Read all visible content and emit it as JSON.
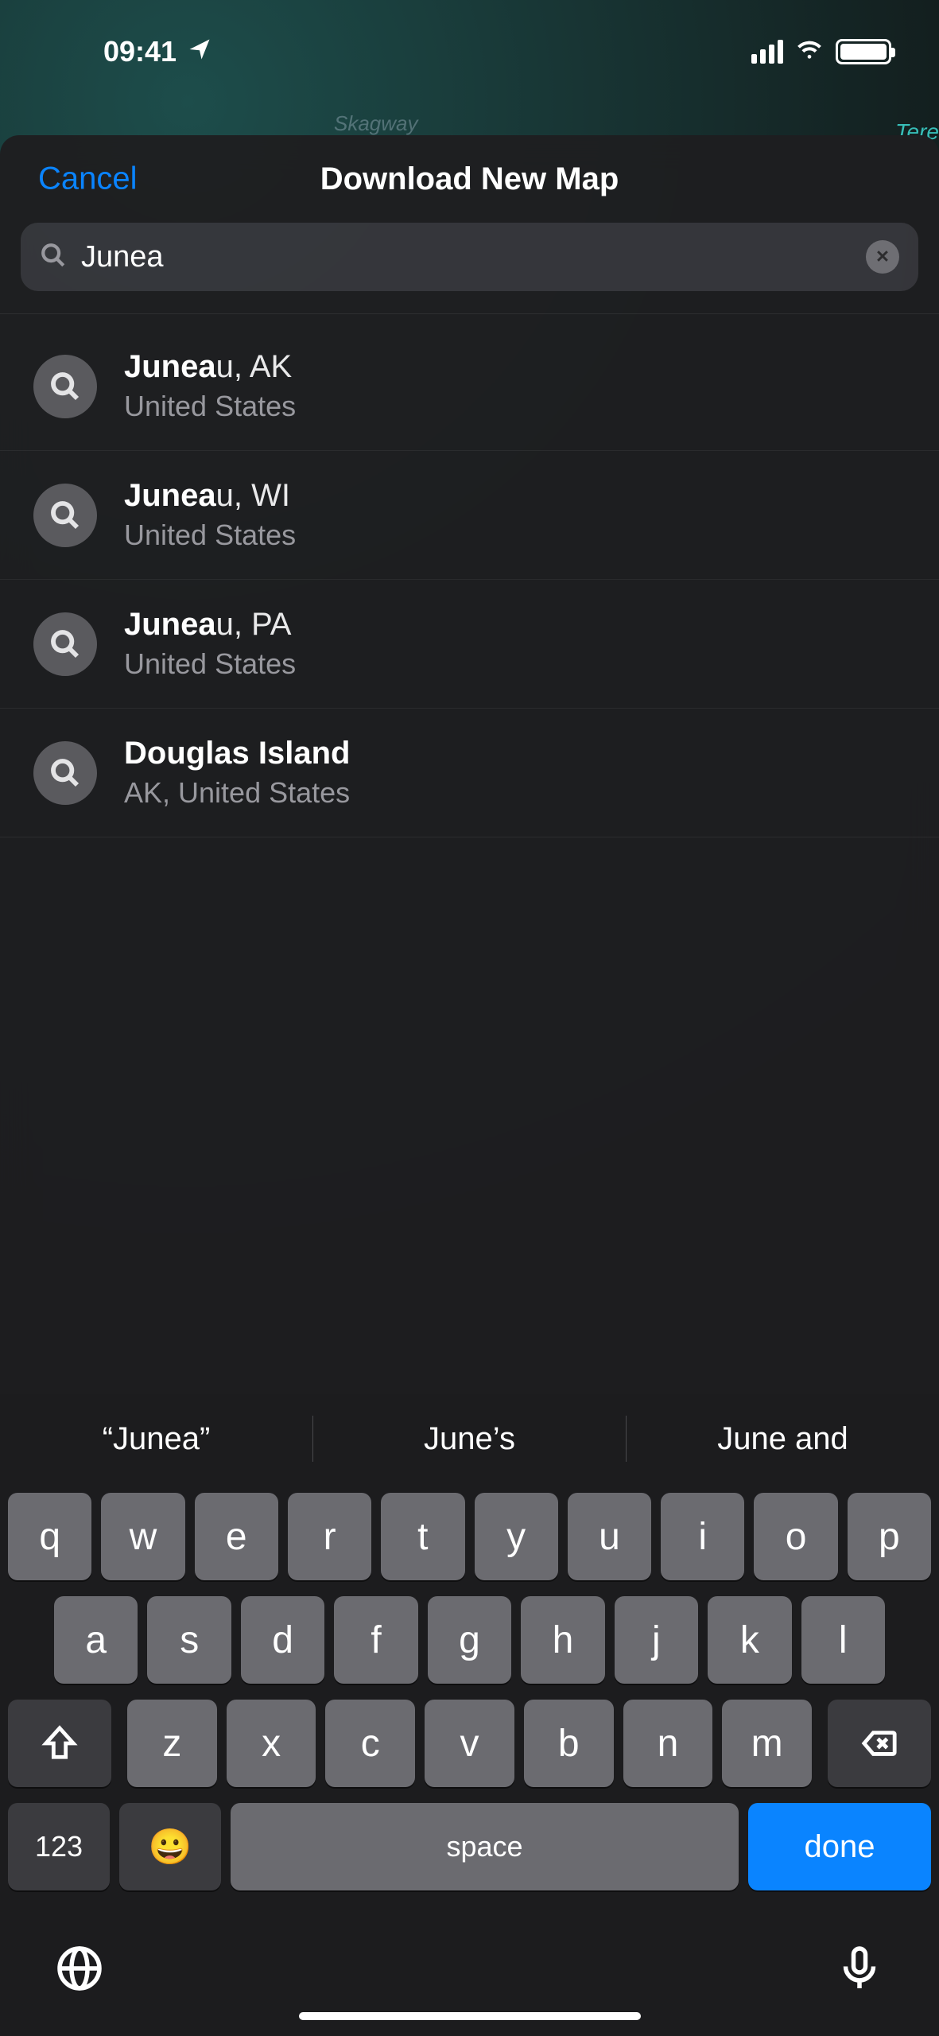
{
  "status": {
    "time": "09:41"
  },
  "bgLabels": {
    "left": "Skagway",
    "right": "Tere"
  },
  "header": {
    "cancel": "Cancel",
    "title": "Download New Map"
  },
  "search": {
    "value": "Junea"
  },
  "results": [
    {
      "match": "Junea",
      "rest": "u, AK",
      "sub": "United States"
    },
    {
      "match": "Junea",
      "rest": "u, WI",
      "sub": "United States"
    },
    {
      "match": "Junea",
      "rest": "u, PA",
      "sub": "United States"
    },
    {
      "match": "Douglas Island",
      "rest": "",
      "sub": "AK, United States"
    }
  ],
  "predictions": [
    "“Junea”",
    "June’s",
    "June and"
  ],
  "keyboard": {
    "row1": [
      "q",
      "w",
      "e",
      "r",
      "t",
      "y",
      "u",
      "i",
      "o",
      "p"
    ],
    "row2": [
      "a",
      "s",
      "d",
      "f",
      "g",
      "h",
      "j",
      "k",
      "l"
    ],
    "row3": [
      "z",
      "x",
      "c",
      "v",
      "b",
      "n",
      "m"
    ],
    "numKey": "123",
    "space": "space",
    "done": "done"
  }
}
